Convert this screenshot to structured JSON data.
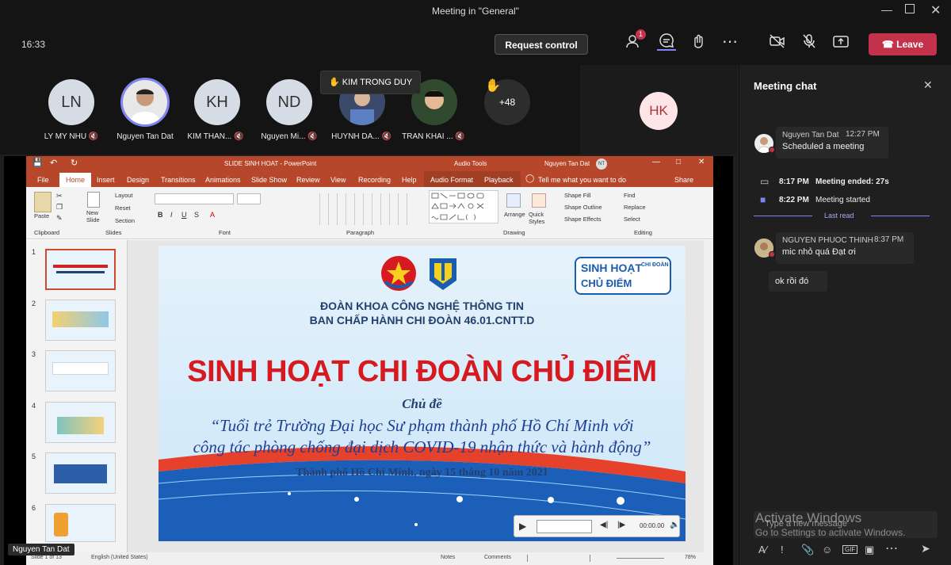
{
  "window": {
    "title": "Meeting in \"General\""
  },
  "toolbar": {
    "time": "16:33",
    "request_control": "Request control",
    "leave": "Leave",
    "participants_badge": "1"
  },
  "participants": [
    {
      "initials": "LN",
      "name": "LY MY NHU"
    },
    {
      "initials": "",
      "name": "Nguyen Tan Dat"
    },
    {
      "initials": "KH",
      "name": "KIM THAN..."
    },
    {
      "initials": "ND",
      "name": "Nguyen Mi..."
    },
    {
      "initials": "",
      "name": "HUYNH DA..."
    },
    {
      "initials": "",
      "name": "TRAN KHAI ..."
    }
  ],
  "raised_hand_name": "KIM TRONG DUY",
  "overflow_count": "+48",
  "hk_initials": "HK",
  "presenter_label": "Nguyen Tan Dat",
  "chat": {
    "title": "Meeting chat",
    "msg1": {
      "sender": "Nguyen Tan Dat",
      "time": "12:27 PM",
      "text": "Scheduled a meeting"
    },
    "ended": {
      "time": "8:17 PM",
      "text": "Meeting ended: 27s"
    },
    "started": {
      "time": "8:22 PM",
      "text": "Meeting started"
    },
    "last_read": "Last read",
    "msg2": {
      "sender": "NGUYEN PHUOC THINH",
      "time": "8:37 PM",
      "text": "mic nhỏ quá Đạt ơi"
    },
    "msg3": {
      "text": "ok rồi đó"
    },
    "input_placeholder": "Type a new message",
    "watermark1": "Activate Windows",
    "watermark2": "Go to Settings to activate Windows."
  },
  "ppt": {
    "title": "SLIDE SINH HOAT  -  PowerPoint",
    "audio_tools": "Audio Tools",
    "user": "Nguyen Tan Dat",
    "user_initials": "NT",
    "tabs": [
      "File",
      "Home",
      "Insert",
      "Design",
      "Transitions",
      "Animations",
      "Slide Show",
      "Review",
      "View",
      "Recording",
      "Help",
      "Audio Format",
      "Playback"
    ],
    "tell_me": "Tell me what you want to do",
    "share": "Share",
    "groups": [
      "Clipboard",
      "Slides",
      "Font",
      "Paragraph",
      "Drawing",
      "Editing"
    ],
    "ribbon": {
      "paste": "Paste",
      "new_slide": "New Slide",
      "layout": "Layout",
      "reset": "Reset",
      "section": "Section",
      "arrange": "Arrange",
      "quick_styles": "Quick Styles",
      "shape_fill": "Shape Fill",
      "shape_outline": "Shape Outline",
      "shape_effects": "Shape Effects",
      "find": "Find",
      "replace": "Replace",
      "select": "Select"
    },
    "slide_numbers": [
      "1",
      "2",
      "3",
      "4",
      "5",
      "6"
    ],
    "status": {
      "slide": "Slide 1 of 13",
      "lang": "English (United States)",
      "notes": "Notes",
      "comments": "Comments",
      "zoom": "78%"
    }
  },
  "slide": {
    "org1": "ĐOÀN KHOA CÔNG NGHỆ THÔNG TIN",
    "org2": "BAN CHẤP HÀNH CHI ĐOÀN 46.01.CNTT.D",
    "badge1": "SINH HOẠT",
    "badge2": "CHỦ ĐIỂM",
    "badge3": "CHI ĐOÀN",
    "main_title": "SINH HOẠT CHI ĐOÀN CHỦ ĐIỂM",
    "subject": "Chủ đề",
    "quote1": "“Tuổi trẻ Trường Đại học Sư phạm thành phố Hồ Chí Minh với",
    "quote2": "công tác phòng chống đại dịch COVID-19 nhận thức và hành động”",
    "date": "Thành phố Hồ Chí Minh, ngày 15 tháng 10 năm 2021",
    "audio_time": "00:00.00"
  }
}
